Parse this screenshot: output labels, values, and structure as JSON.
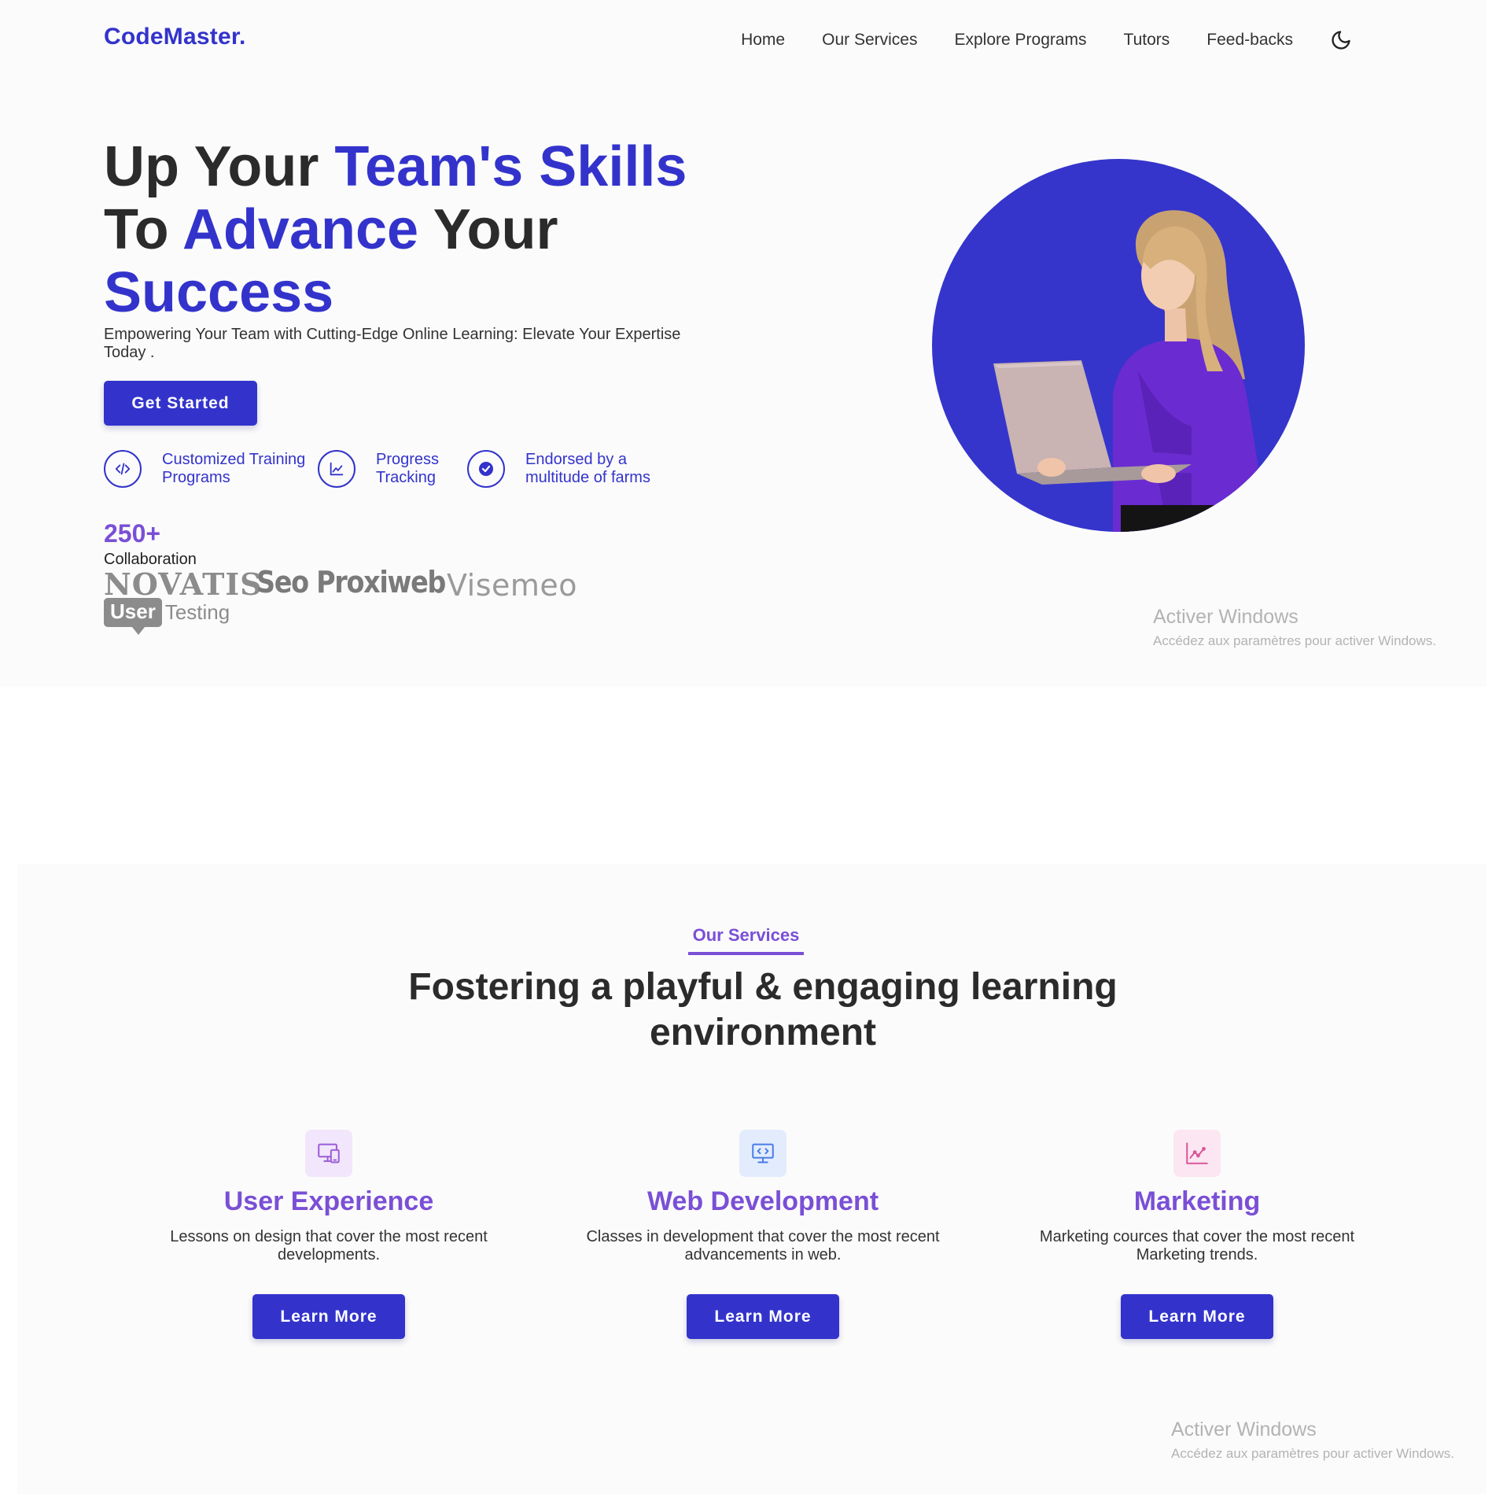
{
  "nav": {
    "logo": "CodeMaster.",
    "links": [
      "Home",
      "Our Services",
      "Explore Programs",
      "Tutors",
      "Feed-backs"
    ],
    "theme_toggle_icon": "moon-icon"
  },
  "hero": {
    "headline": {
      "l1a": "Up Your ",
      "l1b": "Team's Skills",
      "l2a": "To ",
      "l2b": "Advance",
      "l2c": " Your",
      "l3": "Success"
    },
    "subtitle": "Empowering Your Team with Cutting-Edge Online Learning: Elevate Your Expertise Today .",
    "cta_label": "Get Started",
    "features": [
      {
        "label": "Customized Training Programs",
        "icon": "code-icon"
      },
      {
        "label": "Progress Tracking",
        "icon": "chart-icon"
      },
      {
        "label": "Endorsed by a multitude of farms",
        "icon": "verified-badge-icon"
      }
    ],
    "stat_number": "250+",
    "stat_label": "Collaboration",
    "partners": {
      "novatis": "NOVATIS",
      "seo": "Seo Proxiweb",
      "visemeo": "Visemeo",
      "usertesting_a": "User",
      "usertesting_b": "Testing"
    },
    "accent_color": "#3333cc"
  },
  "watermark": {
    "title": "Activer Windows",
    "subtitle": "Accédez aux paramètres pour activer Windows."
  },
  "services": {
    "eyebrow": "Our Services",
    "title_l1": "Fostering a playful & engaging learning",
    "title_l2": "environment",
    "cards": [
      {
        "title": "User Experience",
        "desc": "Lessons on design that cover the most recent developments.",
        "button": "Learn More",
        "icon": "ux-device-icon",
        "icon_bg": "#f1e6fb",
        "icon_color": "#9a5bd8"
      },
      {
        "title": "Web Development",
        "desc": "Classes in development that cover the most recent advancements in web.",
        "button": "Learn More",
        "icon": "code-monitor-icon",
        "icon_bg": "#e2ecfd",
        "icon_color": "#4a7be8"
      },
      {
        "title": "Marketing",
        "desc": "Marketing cources that cover the most recent Marketing trends.",
        "button": "Learn More",
        "icon": "line-chart-icon",
        "icon_bg": "#fbe6f1",
        "icon_color": "#d9569b"
      }
    ]
  }
}
